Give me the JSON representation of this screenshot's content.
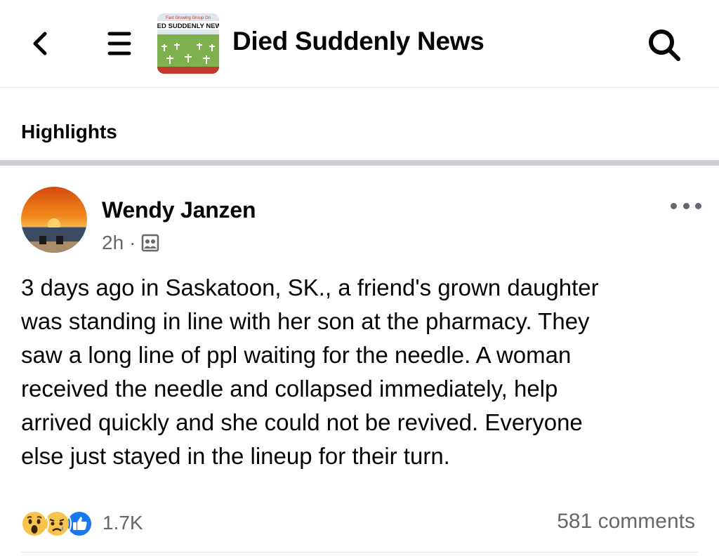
{
  "header": {
    "back_icon": "chevron-left-icon",
    "menu_icon": "hamburger-icon",
    "group_thumb_banner": "Fast Growing Group On",
    "group_thumb_title": "DIED SUDDENLY NEWS",
    "title": "Died Suddenly News",
    "search_icon": "search-icon"
  },
  "tabs": {
    "highlights": "Highlights"
  },
  "post": {
    "author": "Wendy Janzen",
    "time": "2h",
    "separator": "·",
    "audience_icon": "group-audience-icon",
    "more_icon": "more-dots-icon",
    "text": "3 days ago in Saskatoon, SK., a friend's grown daughter\nwas standing in line with her son at the pharmacy. They\nsaw a long line of ppl waiting for the needle. A woman\nreceived the needle and collapsed immediately, help\narrived quickly and she could not be revived. Everyone\nelse just stayed in the lineup for their turn.",
    "reactions": {
      "icons": [
        "wow-reaction-icon",
        "sad-reaction-icon",
        "like-reaction-icon"
      ],
      "count": "1.7K"
    },
    "comments": "581 comments"
  },
  "colors": {
    "text_primary": "#050505",
    "text_secondary": "#65676b",
    "like_blue": "#1877f2",
    "reaction_yellow": "#f7c34c",
    "divider": "#c9ccd1"
  }
}
